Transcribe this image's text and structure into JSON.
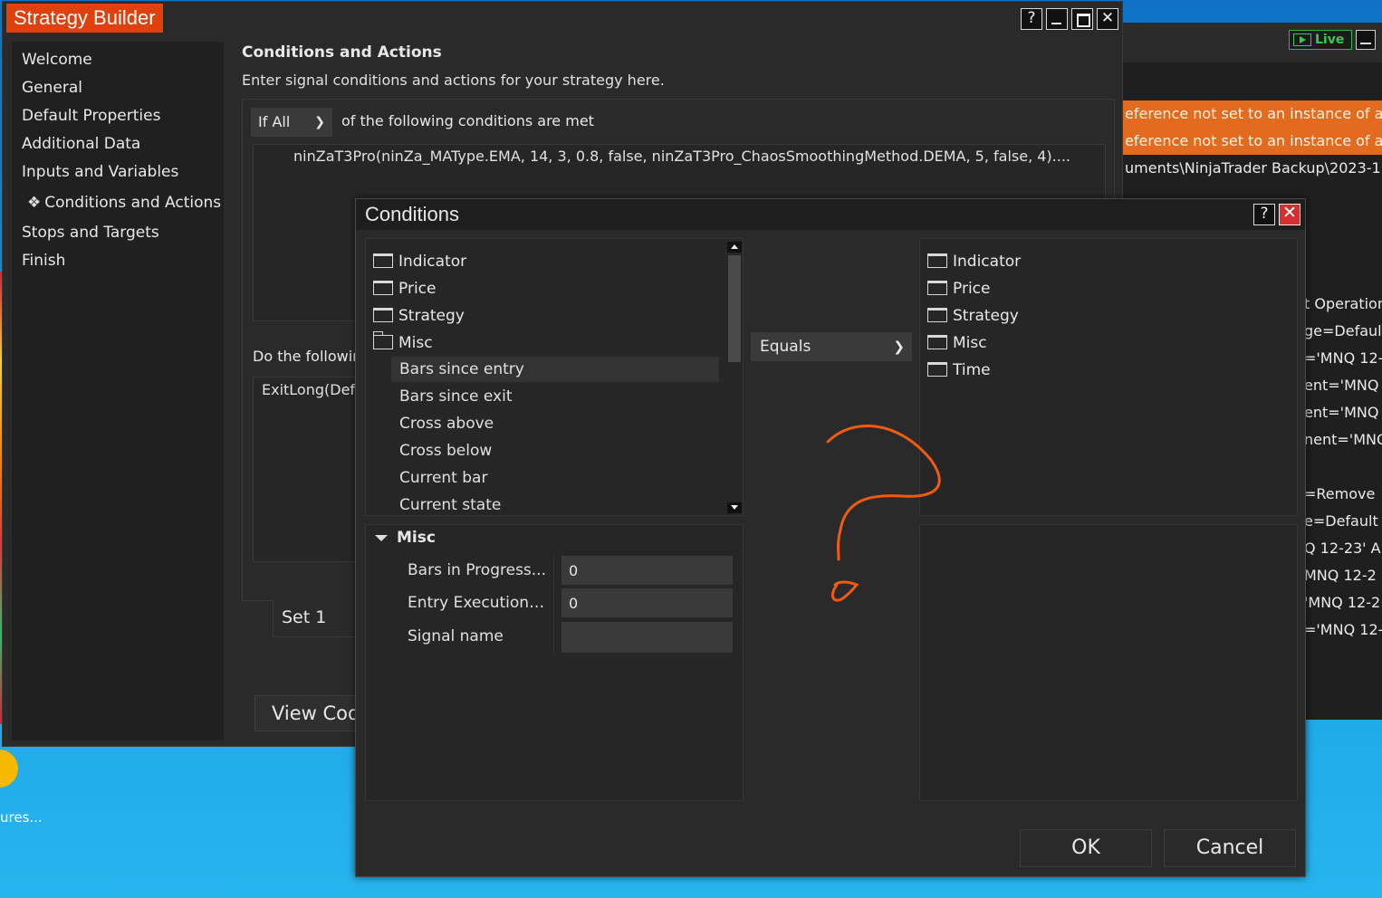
{
  "background_window": {
    "live_label": "Live",
    "error_lines": [
      "eference not set to an instance of an",
      "eference not set to an instance of an"
    ],
    "path_line": "uments\\NinjaTrader Backup\\2023-11",
    "log_lines": [
      "t Operation",
      "ge=Default",
      "='MNQ 12-",
      "ent='MNQ",
      "ent='MNQ",
      "nent='MNQ",
      "",
      "=Remove",
      "e=Default",
      "Q 12-23' A",
      "MNQ 12-2",
      "'MNQ 12-2",
      "='MNQ 12-"
    ]
  },
  "desktop": {
    "icon_label": "ures..."
  },
  "strategy_builder": {
    "title": "Strategy Builder",
    "window_buttons": {
      "help": "?"
    },
    "nav": [
      "Welcome",
      "General",
      "Default Properties",
      "Additional Data",
      "Inputs and Variables",
      "Conditions and Actions",
      "Stops and Targets",
      "Finish"
    ],
    "selected_nav_marker": "❖",
    "section_title": "Conditions and Actions",
    "section_desc": "Enter signal conditions and actions for your strategy here.",
    "if_select": "If All",
    "following_text": "of the following conditions are met",
    "condition_text": "ninZaT3Pro(ninZa_MAType.EMA, 14, 3, 0.8, false, ninZaT3Pro_ChaosSmoothingMethod.DEMA, 5, false, 4)....",
    "do_following": "Do the followin",
    "action_text": "ExitLong(Defa",
    "set_tab": "Set 1",
    "view_code": "View Cod"
  },
  "conditions_dialog": {
    "title": "Conditions",
    "help": "?",
    "close": "✕",
    "left_tree": {
      "folders": [
        "Indicator",
        "Price",
        "Strategy",
        "Misc"
      ],
      "misc_children": [
        "Bars since entry",
        "Bars since exit",
        "Cross above",
        "Cross below",
        "Current bar",
        "Current state"
      ],
      "selected_child": "Bars since entry"
    },
    "operator": "Equals",
    "right_tree": {
      "folders": [
        "Indicator",
        "Price",
        "Strategy",
        "Misc",
        "Time"
      ]
    },
    "properties": {
      "section": "Misc",
      "rows": [
        {
          "label": "Bars in Progress...",
          "value": "0"
        },
        {
          "label": "Entry Executions...",
          "value": "0"
        },
        {
          "label": "Signal name",
          "value": ""
        }
      ]
    },
    "ok_label": "OK",
    "cancel_label": "Cancel"
  },
  "colors": {
    "accent": "#e0400c",
    "error_row": "#e36b1f",
    "annotation": "#f05a12",
    "live_green": "#38c857"
  }
}
